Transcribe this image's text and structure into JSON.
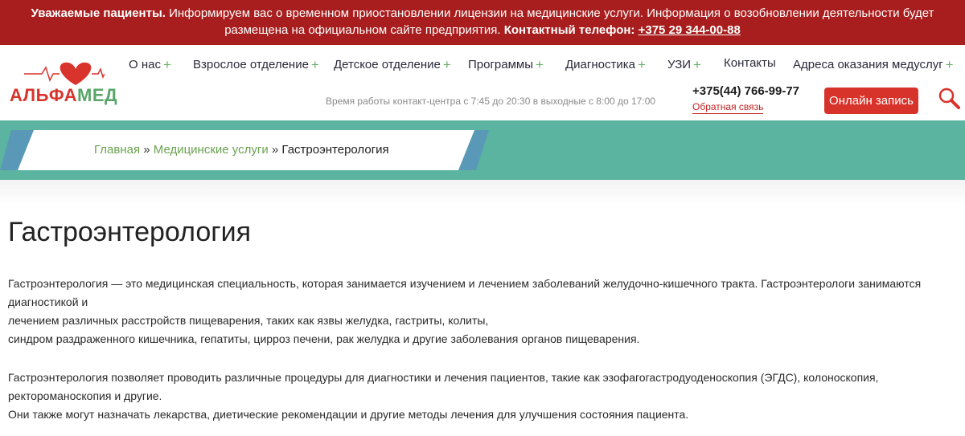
{
  "alert": {
    "lead": "Уважаемые пациенты.",
    "text1": " Информируем вас о временном приостановлении лицензии на медицинские услуги. Информация о возобновлении деятельности будет",
    "text2": "размещена на официальном сайте предприятия. ",
    "phone_label": "Контактный телефон: ",
    "phone": "+375 29 344-00-88"
  },
  "logo": {
    "part1": "АЛЬФА",
    "part2": "МЕД"
  },
  "nav": {
    "items": [
      {
        "label": "О нас",
        "has_sub": true
      },
      {
        "label": "Взрослое отделение",
        "has_sub": true
      },
      {
        "label": "Детское отделение",
        "has_sub": true
      },
      {
        "label": "Программы",
        "has_sub": true
      },
      {
        "label": "Диагностика",
        "has_sub": true
      },
      {
        "label": "УЗИ",
        "has_sub": true
      },
      {
        "label": "Контакты",
        "has_sub": false
      },
      {
        "label": "Адреса оказания медуслуг",
        "has_sub": true
      }
    ],
    "plus": "+"
  },
  "header": {
    "worktime": "Время работы контакт-центра с 7:45 до 20:30 в выходные с 8:00 до 17:00",
    "phone": "+375(44) 766-99-77",
    "callback": "Обратная связь",
    "book_button": "Онлайн запись"
  },
  "breadcrumb": {
    "home": "Главная",
    "sep": " » ",
    "section": "Медицинские услуги",
    "current": "Гастроэнтерология"
  },
  "page": {
    "title": "Гастроэнтерология",
    "p1": [
      "Гастроэнтерология — это медицинская специальность, которая занимается изучением и лечением заболеваний желудочно-кишечного тракта. Гастроэнтерологи занимаются",
      "диагностикой и",
      "лечением различных расстройств пищеварения, таких как язвы желудка, гастриты, колиты,",
      "синдром раздраженного кишечника, гепатиты, цирроз печени, рак желудка и другие заболевания органов пищеварения."
    ],
    "p2": [
      "Гастроэнтерология позволяет проводить различные процедуры для диагностики и лечения пациентов, такие как эзофагогастродуоденоскопия (ЭГДС), колоноскопия,",
      "ректороманоскопия и другие.",
      "Они также могут назначать лекарства, диетические рекомендации и другие методы лечения для улучшения состояния пациента."
    ]
  },
  "colors": {
    "alert_bg": "#a81d1d",
    "brand_red": "#d8332b",
    "brand_green": "#5aa66a",
    "band_teal": "#5bb4a0",
    "link_green": "#69a24f"
  },
  "icons": {
    "logo": "heart-pulse-icon",
    "search": "search-icon"
  }
}
